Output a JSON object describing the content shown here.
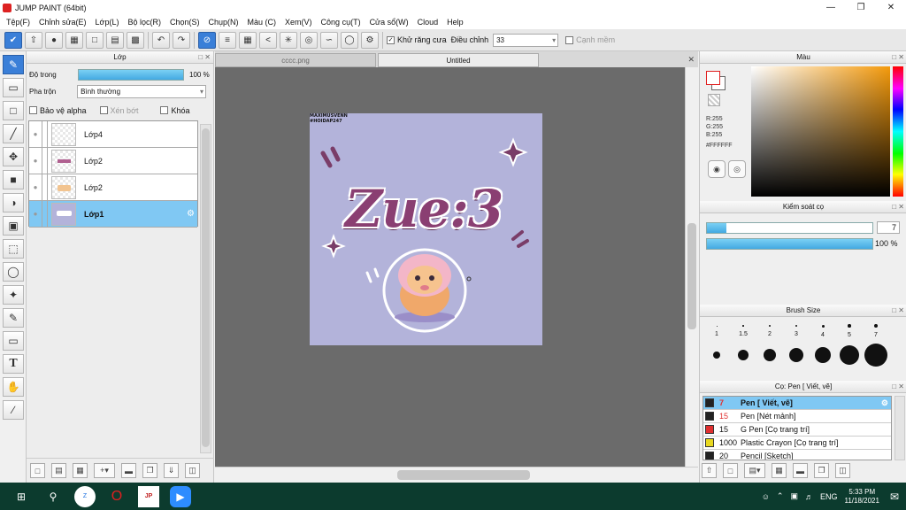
{
  "window": {
    "title": "JUMP PAINT (64bit)"
  },
  "menu": [
    "Tệp(F)",
    "Chỉnh sửa(E)",
    "Lớp(L)",
    "Bộ lọc(R)",
    "Chọn(S)",
    "Chụp(N)",
    "Màu (C)",
    "Xem(V)",
    "Công cụ(T)",
    "Cửa sổ(W)",
    "Cloud",
    "Help"
  ],
  "toolbar": {
    "antialias_label": "Khử răng cưa",
    "adjust_label": "Điều chỉnh",
    "adjust_value": "33",
    "snap_label": "Cạnh mềm"
  },
  "layer_panel": {
    "title": "Lớp",
    "opacity_label": "Độ trong",
    "opacity_value": "100 %",
    "opacity": 1.0,
    "blend_label": "Pha trộn",
    "blend_value": "Bình thường",
    "protect_alpha": "Bảo vệ alpha",
    "clip": "Xén bớt",
    "lock": "Khóa",
    "layers": [
      {
        "name": "Lớp4",
        "selected": false
      },
      {
        "name": "Lớp2",
        "selected": false
      },
      {
        "name": "Lớp2",
        "selected": false
      },
      {
        "name": "Lớp1",
        "selected": true
      }
    ]
  },
  "tabs": [
    "cccc.png",
    "Untitled"
  ],
  "canvas": {
    "watermark_line1": "MAXIMUSVENN",
    "watermark_line2": "#HOIDAP247",
    "title_text": "Zue:3"
  },
  "color_panel": {
    "title": "Màu",
    "r": "R:255",
    "g": "G:255",
    "b": "B:255",
    "hex": "#FFFFFF",
    "foreground": "#ffffff",
    "hue_color": "#f49a0c"
  },
  "brush_control": {
    "title": "Kiểm soát cọ",
    "size_value": "7",
    "size_fraction": 0.12,
    "opacity_value": "100 %",
    "opacity_fraction": 1.0
  },
  "brush_size": {
    "title": "Brush Size",
    "small_labels": [
      "1",
      "1.5",
      "2",
      "3",
      "4",
      "5",
      "7"
    ],
    "large_sizes": [
      8,
      9,
      10,
      11,
      12,
      14,
      16
    ]
  },
  "brush_list": {
    "title": "Cọ: Pen [ Viết, vẽ]",
    "items": [
      {
        "size": "7",
        "name": "Pen [ Viết, vẽ]",
        "color": "#222222",
        "selected": true
      },
      {
        "size": "15",
        "name": "Pen [Nét mảnh]",
        "color": "#222222",
        "selected": false
      },
      {
        "size": "15",
        "name": "G Pen [Cọ trang trí]",
        "color": "#e03030",
        "selected": false
      },
      {
        "size": "1000",
        "name": "Plastic Crayon [Cọ trang trí]",
        "color": "#e8d820",
        "selected": false
      },
      {
        "size": "20",
        "name": "Pencil [Sketch]",
        "color": "#222222",
        "selected": false
      }
    ]
  },
  "taskbar": {
    "lang": "ENG",
    "time": "5:33 PM",
    "date": "11/18/2021"
  }
}
